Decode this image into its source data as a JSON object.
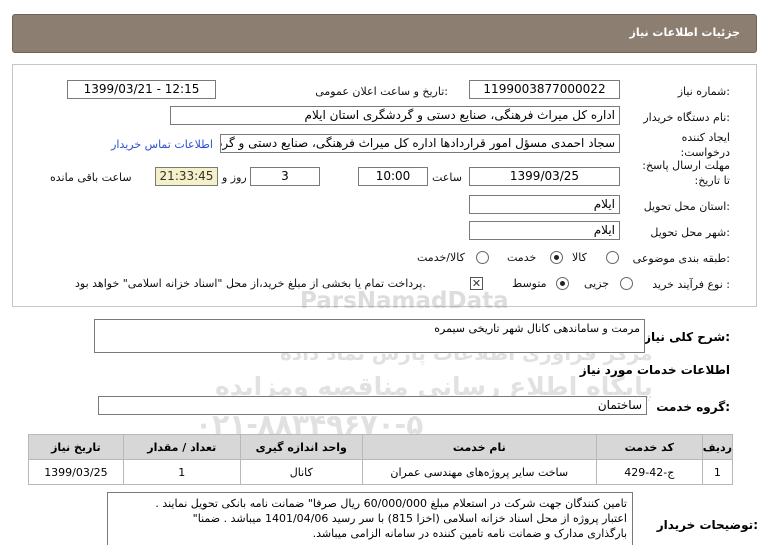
{
  "header": {
    "title": "جزئیات اطلاعات نیاز"
  },
  "fields": {
    "need_number": {
      "label": "شماره نیاز:",
      "value": "1199003877000022"
    },
    "announce_datetime": {
      "label": "تاریخ و ساعت اعلان عمومی:",
      "value": "1399/03/21 - 12:15"
    },
    "buyer_org": {
      "label": "نام دستگاه خریدار:",
      "value": "اداره کل میراث فرهنگی، صنایع دستی و گردشگری استان ایلام"
    },
    "requester": {
      "label": "ایجاد کننده درخواست:",
      "value": "سجاد احمدی مسؤل امور قراردادها اداره کل میراث فرهنگی، صنایع دستی و گردشگری استان ایلام"
    },
    "contact_link": "اطلاعات تماس خریدار",
    "deadline": {
      "label": "مهلت ارسال پاسخ: تا تاریخ:",
      "date": "1399/03/25",
      "time_label": "ساعت",
      "time": "10:00",
      "days": "3",
      "days_label": "روز و",
      "remaining": "21:33:45",
      "remaining_label": "ساعت باقی مانده"
    },
    "delivery_province": {
      "label": "استان محل تحویل:",
      "value": "ایلام"
    },
    "delivery_city": {
      "label": "شهر محل تحویل:",
      "value": "ایلام"
    },
    "category": {
      "label": "طبقه بندی موضوعی:",
      "options": [
        "کالا",
        "خدمت",
        "کالا/خدمت"
      ],
      "selected": "خدمت"
    },
    "purchase_process": {
      "label": "نوع فرآیند خرید :",
      "options": [
        "جزیی",
        "متوسط"
      ],
      "selected": "متوسط",
      "payment_note": "پرداخت تمام یا بخشی از مبلغ خرید،از محل \"اسناد خزانه اسلامی\" خواهد بود.",
      "payment_checked": true
    }
  },
  "general_desc": {
    "label": "شرح کلی نیاز:",
    "value": "مرمت و ساماندهی کانال شهر تاریخی سیمره"
  },
  "services_section": {
    "title": "اطلاعات خدمات مورد نیاز",
    "group_label": "گروه خدمت:",
    "group_value": "ساختمان",
    "table": {
      "headers": [
        "ردیف",
        "کد خدمت",
        "نام خدمت",
        "واحد اندازه گیری",
        "تعداد / مقدار",
        "تاریخ نیاز"
      ],
      "rows": [
        [
          "1",
          "ج-42-429",
          "ساخت سایر پروژه‌های مهندسی عمران",
          "کانال",
          "1",
          "1399/03/25"
        ]
      ]
    }
  },
  "notes": {
    "label": "توضیحات خریدار:",
    "lines": [
      "تامین کنندگان جهت شرکت در استعلام مبلغ 60/000/000 ریال صرفا\" ضمانت نامه بانکی تحویل نمایند .",
      "اعتبار پروژه از محل اسناد خزانه اسلامی (اخزا 815) با سر رسید 1401/04/06 میباشد . ضمنا\"",
      "بارگذاری مدارک و ضمانت نامه تامین کننده در سامانه الزامی میباشد."
    ]
  },
  "watermark": {
    "brand": "ParsNamadData",
    "line1": "مرکز فراوری اطلاعات پارس نماد داده",
    "line2": "پایگاه اطلاع رسانی مناقصه ومزایده",
    "phone": "۰۲۱-۸۸۳۴۹۶۷۰-۵"
  }
}
